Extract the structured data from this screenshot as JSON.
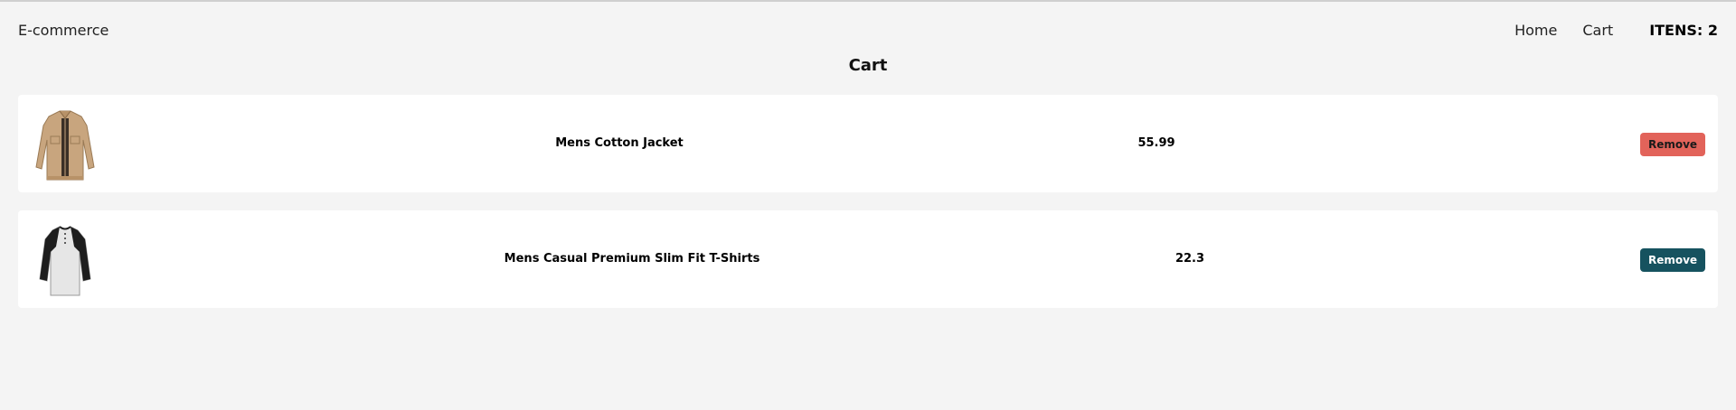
{
  "header": {
    "brand": "E-commerce",
    "nav": {
      "home": "Home",
      "cart": "Cart",
      "items_count": "ITENS: 2"
    }
  },
  "page": {
    "title": "Cart"
  },
  "cart": {
    "items": [
      {
        "name": "Mens Cotton Jacket",
        "price": "55.99",
        "remove_label": "Remove",
        "image": "khaki-cotton-jacket",
        "button_color": "#e2635a"
      },
      {
        "name": "Mens Casual Premium Slim Fit T-Shirts",
        "price": "22.3",
        "remove_label": "Remove",
        "image": "raglan-slim-fit-t-shirt",
        "button_color": "#16525f"
      }
    ]
  },
  "colors": {
    "background": "#f4f4f4",
    "card": "#ffffff",
    "remove_red": "#e2635a",
    "remove_teal": "#16525f"
  }
}
